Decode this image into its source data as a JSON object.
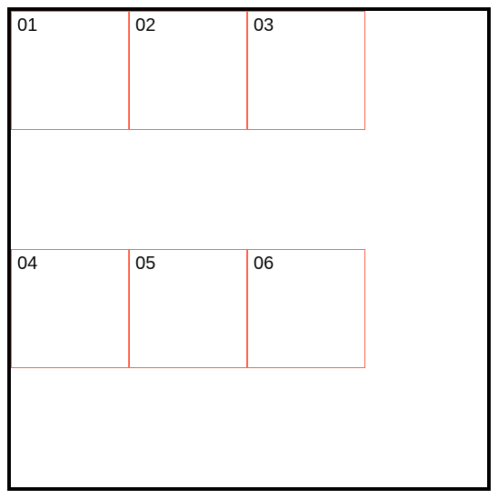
{
  "grid": {
    "row1": {
      "cell1": "01",
      "cell2": "02",
      "cell3": "03"
    },
    "row2": {
      "cell1": "04",
      "cell2": "05",
      "cell3": "06"
    }
  }
}
